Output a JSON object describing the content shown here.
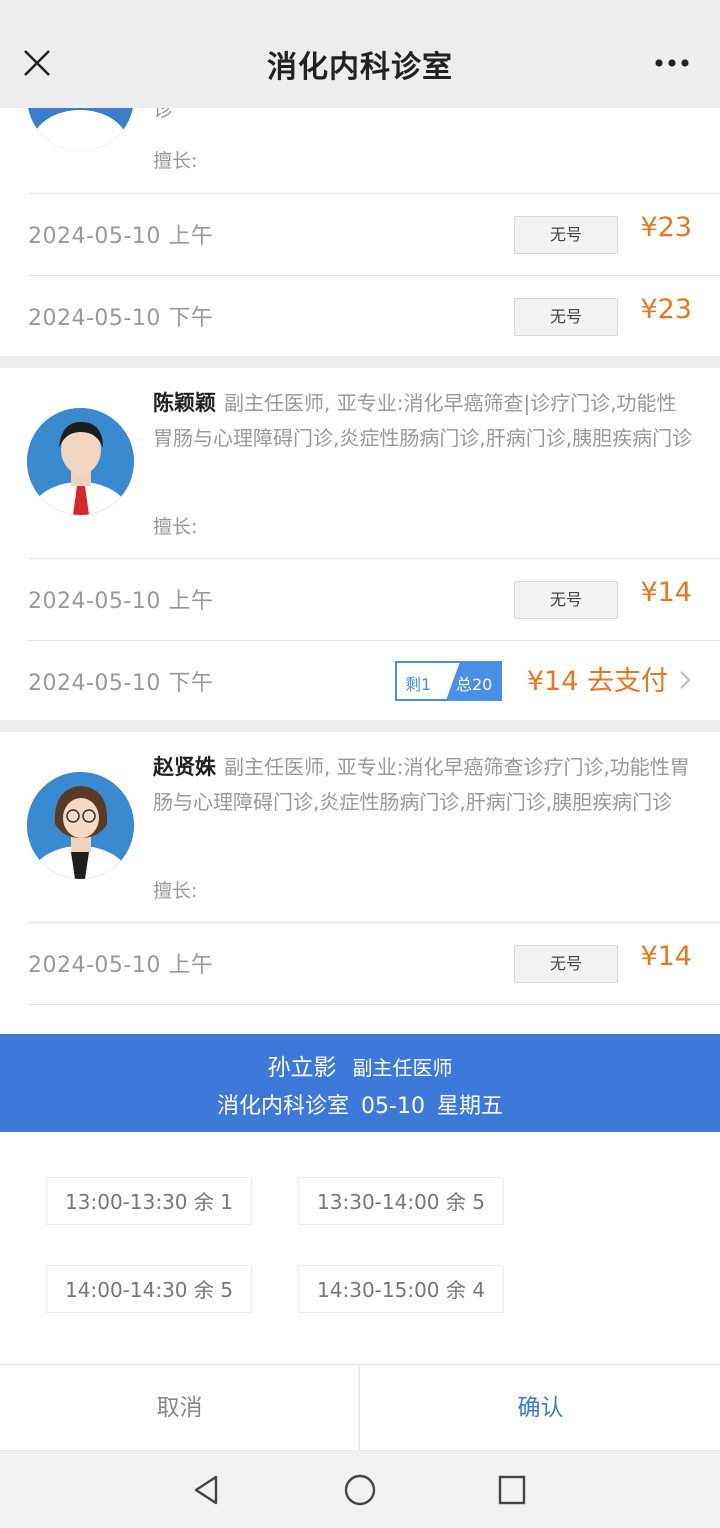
{
  "header": {
    "title": "消化内科诊室"
  },
  "doctors": [
    {
      "info_tail": "诊",
      "skill": "擅长:",
      "slots": [
        {
          "date": "2024-05-10 上午",
          "status": "无号",
          "price": "¥23"
        },
        {
          "date": "2024-05-10 下午",
          "status": "无号",
          "price": "¥23"
        }
      ]
    },
    {
      "name": "陈颖颖",
      "title": "副主任医师, 亚专业:消化早癌筛查|诊疗门诊,功能性胃肠与心理障碍门诊,炎症性肠病门诊,肝病门诊,胰胆疾病门诊",
      "skill": "擅长:",
      "slots": [
        {
          "date": "2024-05-10 上午",
          "status": "无号",
          "price": "¥14"
        },
        {
          "date": "2024-05-10 下午",
          "remain": "剩1",
          "total": "总20",
          "pay": "¥14 去支付"
        }
      ]
    },
    {
      "name": "赵贤姝",
      "title": "副主任医师, 亚专业:消化早癌筛查诊疗门诊,功能性胃肠与心理障碍门诊,炎症性肠病门诊,肝病门诊,胰胆疾病门诊",
      "skill": "擅长:",
      "slots": [
        {
          "date": "2024-05-10 上午",
          "status": "无号",
          "price": "¥14"
        }
      ]
    }
  ],
  "sheet": {
    "doctor_name": "孙立影",
    "doctor_rank": "副主任医师",
    "dept": "消化内科诊室",
    "date": "05-10",
    "weekday": "星期五",
    "times": [
      {
        "label": "13:00-13:30 余 1"
      },
      {
        "label": "13:30-14:00 余 5"
      },
      {
        "label": "14:00-14:30 余 5"
      },
      {
        "label": "14:30-15:00 余 4"
      }
    ],
    "cancel": "取消",
    "confirm": "确认"
  },
  "colors": {
    "primary": "#3d79d9",
    "price": "#e8771f"
  },
  "icons": [
    "close-icon",
    "more-icon",
    "chevron-right-icon",
    "nav-back-icon",
    "nav-home-icon",
    "nav-recent-icon"
  ]
}
